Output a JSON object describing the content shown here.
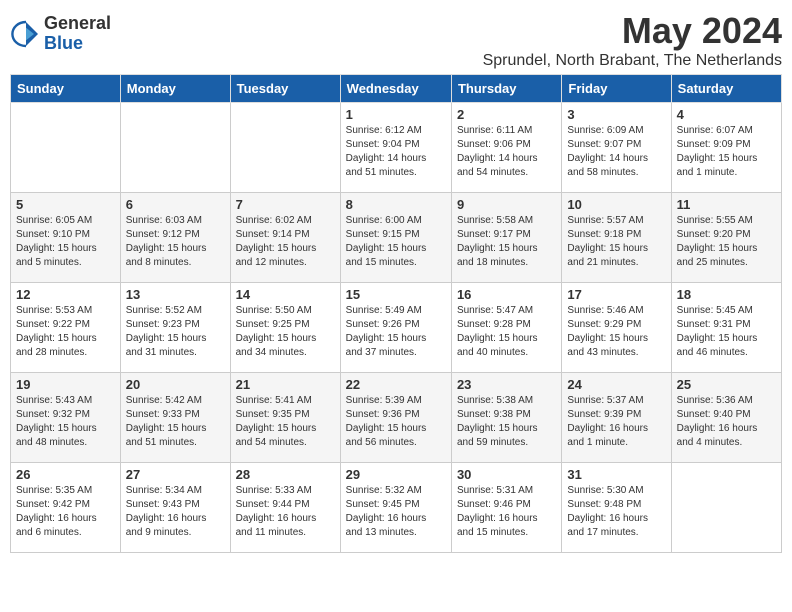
{
  "logo": {
    "general": "General",
    "blue": "Blue"
  },
  "title": "May 2024",
  "subtitle": "Sprundel, North Brabant, The Netherlands",
  "days_of_week": [
    "Sunday",
    "Monday",
    "Tuesday",
    "Wednesday",
    "Thursday",
    "Friday",
    "Saturday"
  ],
  "weeks": [
    [
      {
        "day": "",
        "info": ""
      },
      {
        "day": "",
        "info": ""
      },
      {
        "day": "",
        "info": ""
      },
      {
        "day": "1",
        "info": "Sunrise: 6:12 AM\nSunset: 9:04 PM\nDaylight: 14 hours\nand 51 minutes."
      },
      {
        "day": "2",
        "info": "Sunrise: 6:11 AM\nSunset: 9:06 PM\nDaylight: 14 hours\nand 54 minutes."
      },
      {
        "day": "3",
        "info": "Sunrise: 6:09 AM\nSunset: 9:07 PM\nDaylight: 14 hours\nand 58 minutes."
      },
      {
        "day": "4",
        "info": "Sunrise: 6:07 AM\nSunset: 9:09 PM\nDaylight: 15 hours\nand 1 minute."
      }
    ],
    [
      {
        "day": "5",
        "info": "Sunrise: 6:05 AM\nSunset: 9:10 PM\nDaylight: 15 hours\nand 5 minutes."
      },
      {
        "day": "6",
        "info": "Sunrise: 6:03 AM\nSunset: 9:12 PM\nDaylight: 15 hours\nand 8 minutes."
      },
      {
        "day": "7",
        "info": "Sunrise: 6:02 AM\nSunset: 9:14 PM\nDaylight: 15 hours\nand 12 minutes."
      },
      {
        "day": "8",
        "info": "Sunrise: 6:00 AM\nSunset: 9:15 PM\nDaylight: 15 hours\nand 15 minutes."
      },
      {
        "day": "9",
        "info": "Sunrise: 5:58 AM\nSunset: 9:17 PM\nDaylight: 15 hours\nand 18 minutes."
      },
      {
        "day": "10",
        "info": "Sunrise: 5:57 AM\nSunset: 9:18 PM\nDaylight: 15 hours\nand 21 minutes."
      },
      {
        "day": "11",
        "info": "Sunrise: 5:55 AM\nSunset: 9:20 PM\nDaylight: 15 hours\nand 25 minutes."
      }
    ],
    [
      {
        "day": "12",
        "info": "Sunrise: 5:53 AM\nSunset: 9:22 PM\nDaylight: 15 hours\nand 28 minutes."
      },
      {
        "day": "13",
        "info": "Sunrise: 5:52 AM\nSunset: 9:23 PM\nDaylight: 15 hours\nand 31 minutes."
      },
      {
        "day": "14",
        "info": "Sunrise: 5:50 AM\nSunset: 9:25 PM\nDaylight: 15 hours\nand 34 minutes."
      },
      {
        "day": "15",
        "info": "Sunrise: 5:49 AM\nSunset: 9:26 PM\nDaylight: 15 hours\nand 37 minutes."
      },
      {
        "day": "16",
        "info": "Sunrise: 5:47 AM\nSunset: 9:28 PM\nDaylight: 15 hours\nand 40 minutes."
      },
      {
        "day": "17",
        "info": "Sunrise: 5:46 AM\nSunset: 9:29 PM\nDaylight: 15 hours\nand 43 minutes."
      },
      {
        "day": "18",
        "info": "Sunrise: 5:45 AM\nSunset: 9:31 PM\nDaylight: 15 hours\nand 46 minutes."
      }
    ],
    [
      {
        "day": "19",
        "info": "Sunrise: 5:43 AM\nSunset: 9:32 PM\nDaylight: 15 hours\nand 48 minutes."
      },
      {
        "day": "20",
        "info": "Sunrise: 5:42 AM\nSunset: 9:33 PM\nDaylight: 15 hours\nand 51 minutes."
      },
      {
        "day": "21",
        "info": "Sunrise: 5:41 AM\nSunset: 9:35 PM\nDaylight: 15 hours\nand 54 minutes."
      },
      {
        "day": "22",
        "info": "Sunrise: 5:39 AM\nSunset: 9:36 PM\nDaylight: 15 hours\nand 56 minutes."
      },
      {
        "day": "23",
        "info": "Sunrise: 5:38 AM\nSunset: 9:38 PM\nDaylight: 15 hours\nand 59 minutes."
      },
      {
        "day": "24",
        "info": "Sunrise: 5:37 AM\nSunset: 9:39 PM\nDaylight: 16 hours\nand 1 minute."
      },
      {
        "day": "25",
        "info": "Sunrise: 5:36 AM\nSunset: 9:40 PM\nDaylight: 16 hours\nand 4 minutes."
      }
    ],
    [
      {
        "day": "26",
        "info": "Sunrise: 5:35 AM\nSunset: 9:42 PM\nDaylight: 16 hours\nand 6 minutes."
      },
      {
        "day": "27",
        "info": "Sunrise: 5:34 AM\nSunset: 9:43 PM\nDaylight: 16 hours\nand 9 minutes."
      },
      {
        "day": "28",
        "info": "Sunrise: 5:33 AM\nSunset: 9:44 PM\nDaylight: 16 hours\nand 11 minutes."
      },
      {
        "day": "29",
        "info": "Sunrise: 5:32 AM\nSunset: 9:45 PM\nDaylight: 16 hours\nand 13 minutes."
      },
      {
        "day": "30",
        "info": "Sunrise: 5:31 AM\nSunset: 9:46 PM\nDaylight: 16 hours\nand 15 minutes."
      },
      {
        "day": "31",
        "info": "Sunrise: 5:30 AM\nSunset: 9:48 PM\nDaylight: 16 hours\nand 17 minutes."
      },
      {
        "day": "",
        "info": ""
      }
    ]
  ]
}
